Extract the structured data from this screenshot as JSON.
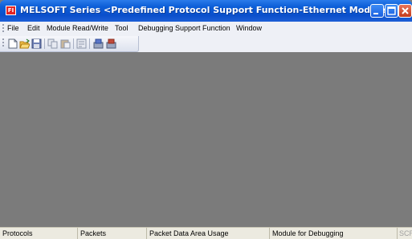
{
  "window": {
    "title": "MELSOFT Series <Predefined Protocol Support Function-Ethernet Module>",
    "icon_label": "FI"
  },
  "menu": {
    "items": [
      {
        "label": "File"
      },
      {
        "label": "Edit"
      },
      {
        "label": "Module Read/Write"
      },
      {
        "label": "Tool"
      },
      {
        "label": "Debugging Support Function"
      },
      {
        "label": "Window"
      }
    ]
  },
  "toolbar": {
    "icons": [
      "new-file-icon",
      "open-folder-icon",
      "save-icon",
      "copy-icon",
      "paste-icon",
      "cut-icon",
      "read-from-module-icon",
      "write-to-module-icon"
    ]
  },
  "statusbar": {
    "protocols": "Protocols",
    "packets": "Packets",
    "packet_data_area_usage": "Packet Data Area Usage",
    "module_for_debugging": "Module for Debugging",
    "scroll": "SCR"
  },
  "colors": {
    "titlebar": "#0a4fcb",
    "workspace": "#7b7b7b",
    "menubar": "#eef0f6",
    "statusbar": "#eceae0",
    "close_button": "#c23b1b"
  }
}
